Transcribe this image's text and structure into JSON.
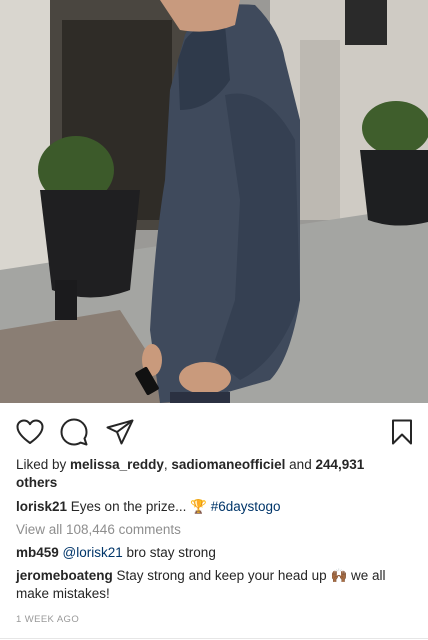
{
  "post": {
    "image": {
      "alt_icon": "photo-of-man-in-hoodie"
    },
    "actions": {
      "like_icon": "heart-icon",
      "comment_icon": "comment-icon",
      "share_icon": "send-icon",
      "save_icon": "bookmark-icon"
    },
    "likes": {
      "prefix": "Liked by ",
      "user1": "melissa_reddy",
      "separator": ", ",
      "user2": "sadiomaneofficiel",
      "and_text": " and ",
      "others_count": "244,931",
      "others_word": "others"
    },
    "caption": {
      "username": "lorisk21",
      "text": " Eyes on the prize... ",
      "emoji": "🏆",
      "hashtag": "#6daystogo"
    },
    "view_all_comments": "View all 108,446 comments",
    "comments": [
      {
        "username": "mb459",
        "mention": "@lorisk21",
        "text": " bro stay strong"
      },
      {
        "username": "jeromeboateng",
        "text": " Stay strong and keep your head up ",
        "emoji": "🙌🏾",
        "text2": " we all make mistakes!"
      }
    ],
    "timestamp": "1 WEEK AGO"
  },
  "colors": {
    "text": "#262626",
    "hashtag": "#003569",
    "muted": "#8e8e8e",
    "hoodie": "#3f4a5c"
  }
}
